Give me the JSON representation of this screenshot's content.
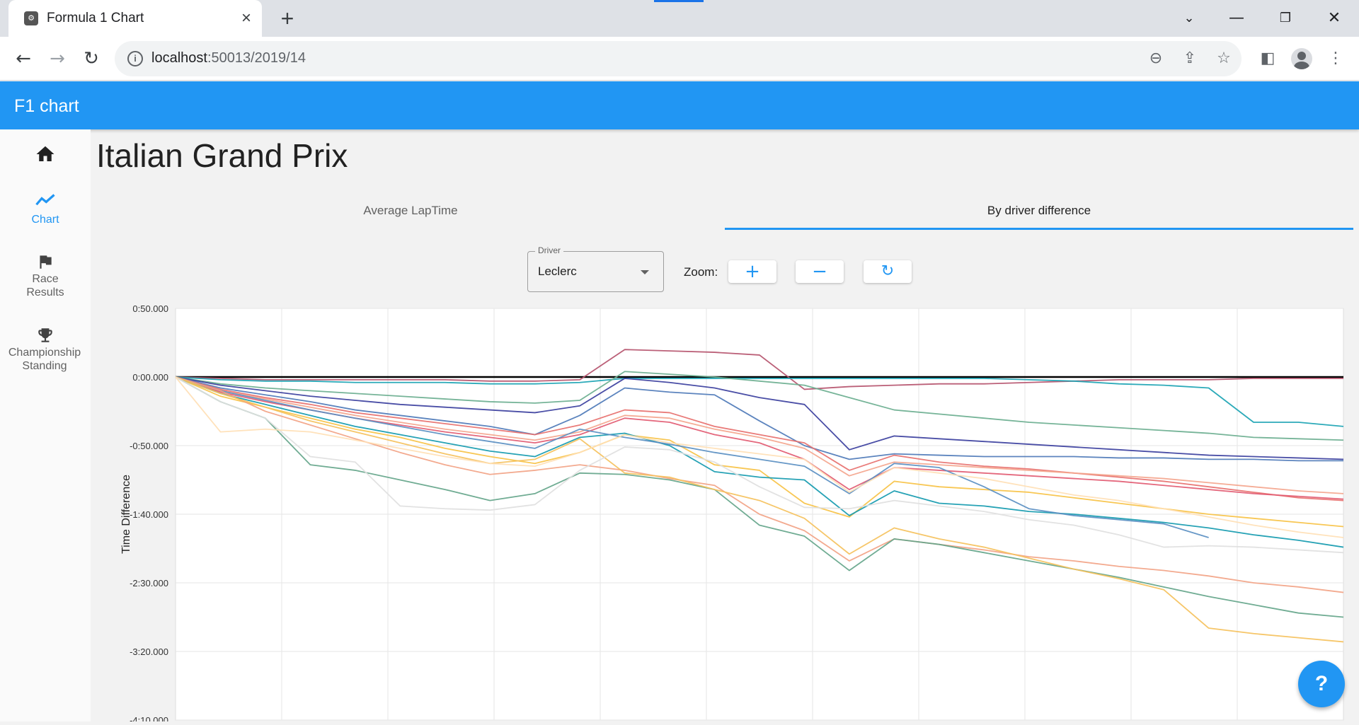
{
  "browser": {
    "tab_title": "Formula 1 Chart",
    "url_host": "localhost",
    "url_rest": ":50013/2019/14"
  },
  "app": {
    "title": "F1 chart"
  },
  "rail": {
    "items": [
      {
        "label": "",
        "icon": "home-icon"
      },
      {
        "label": "Chart",
        "icon": "chart-line-icon",
        "active": true
      },
      {
        "label": "Race Results",
        "icon": "flag-icon"
      },
      {
        "label": "Championship Standing",
        "icon": "trophy-icon"
      }
    ]
  },
  "page": {
    "title": "Italian Grand Prix"
  },
  "tabs": [
    {
      "label": "Average LapTime",
      "active": false
    },
    {
      "label": "By driver difference",
      "active": true
    }
  ],
  "controls": {
    "driver_label": "Driver",
    "driver_value": "Leclerc",
    "zoom_label": "Zoom:"
  },
  "chart_data": {
    "type": "line",
    "ylabel": "Time Difference",
    "ytick_labels": [
      "0:50.000",
      "0:00.000",
      "-0:50.000",
      "-1:40.000",
      "-2:30.000",
      "-3:20.000",
      "-4:10.000"
    ],
    "ylim_seconds": [
      -250,
      50
    ],
    "x": [
      1,
      3,
      5,
      7,
      9,
      11,
      13,
      15,
      17,
      19,
      21,
      23,
      25,
      27,
      29,
      31,
      33,
      35,
      37,
      39,
      41,
      43,
      45,
      47,
      49,
      51,
      53
    ],
    "series": [
      {
        "color": "#000000",
        "values": [
          0,
          0,
          0,
          0,
          0,
          0,
          0,
          0,
          0,
          0,
          0,
          0,
          0,
          0,
          0,
          0,
          0,
          0,
          0,
          0,
          0,
          0,
          0,
          0,
          0,
          0,
          0
        ]
      },
      {
        "color": "#b5526d",
        "values": [
          0,
          -1,
          -2,
          -2,
          -2,
          -2,
          -2,
          -3,
          -3,
          -2,
          20,
          19,
          18,
          16,
          -9,
          -7,
          -6,
          -5,
          -5,
          -4,
          -3,
          -2,
          -2,
          -2,
          -1,
          -1,
          -1
        ]
      },
      {
        "color": "#1aa3b3",
        "values": [
          0,
          -2,
          -3,
          -3,
          -4,
          -4,
          -4,
          -5,
          -5,
          -4,
          -1,
          -1,
          -1,
          -1,
          -1,
          -1,
          -1,
          -1,
          -1,
          -2,
          -3,
          -5,
          -6,
          -8,
          -33,
          -33,
          -36
        ]
      },
      {
        "color": "#6aae8f",
        "values": [
          0,
          -5,
          -8,
          -10,
          -12,
          -14,
          -16,
          -18,
          -19,
          -17,
          4,
          2,
          0,
          -3,
          -6,
          -15,
          -24,
          -27,
          -30,
          -33,
          -35,
          -37,
          -39,
          -41,
          -44,
          -45,
          -46
        ]
      },
      {
        "color": "#3b3f9e",
        "values": [
          0,
          -6,
          -10,
          -14,
          -17,
          -20,
          -22,
          -24,
          -26,
          -21,
          -1,
          -4,
          -8,
          -15,
          -20,
          -53,
          -43,
          -45,
          -47,
          -49,
          -51,
          -53,
          -55,
          -57,
          -58,
          -59,
          -60
        ]
      },
      {
        "color": "#4e7ab8",
        "values": [
          0,
          -8,
          -13,
          -18,
          -24,
          -28,
          -32,
          -36,
          -42,
          -28,
          -8,
          -11,
          -13,
          -32,
          -50,
          -60,
          -56,
          -57,
          -58,
          -58,
          -58,
          -59,
          -59,
          -60,
          -60,
          -61,
          -61
        ]
      },
      {
        "color": "#e7706e",
        "values": [
          0,
          -9,
          -15,
          -20,
          -26,
          -30,
          -34,
          -38,
          -42,
          -35,
          -24,
          -26,
          -36,
          -42,
          -48,
          -68,
          -57,
          -62,
          -65,
          -67,
          -70,
          -73,
          -76,
          -80,
          -84,
          -88,
          -90
        ]
      },
      {
        "color": "#f4a58d",
        "values": [
          0,
          -10,
          -16,
          -22,
          -28,
          -33,
          -38,
          -42,
          -46,
          -40,
          -28,
          -30,
          -38,
          -44,
          -52,
          -72,
          -62,
          -64,
          -66,
          -68,
          -70,
          -72,
          -74,
          -77,
          -80,
          -83,
          -85
        ]
      },
      {
        "color": "#e25b72",
        "values": [
          0,
          -11,
          -18,
          -24,
          -30,
          -35,
          -40,
          -44,
          -48,
          -42,
          -30,
          -33,
          -42,
          -48,
          -60,
          -82,
          -66,
          -68,
          -70,
          -72,
          -74,
          -76,
          -79,
          -82,
          -85,
          -87,
          -89
        ]
      },
      {
        "color": "#f7c245",
        "values": [
          0,
          -14,
          -22,
          -30,
          -38,
          -44,
          -52,
          -58,
          -63,
          -55,
          -42,
          -46,
          -64,
          -68,
          -92,
          -102,
          -76,
          -80,
          -82,
          -84,
          -88,
          -92,
          -96,
          -100,
          -103,
          -106,
          -109
        ]
      },
      {
        "color": "#149aaf",
        "values": [
          0,
          -12,
          -20,
          -28,
          -36,
          -42,
          -48,
          -54,
          -58,
          -44,
          -41,
          -50,
          -69,
          -73,
          -75,
          -101,
          -83,
          -92,
          -94,
          -98,
          -100,
          -103,
          -106,
          -110,
          -115,
          -119,
          -124
        ]
      },
      {
        "color": "#5a8fc2",
        "values": [
          0,
          -10,
          -17,
          -24,
          -30,
          -36,
          -42,
          -47,
          -52,
          -38,
          -44,
          -49,
          -55,
          -60,
          -65,
          -85,
          -63,
          -66,
          -80,
          -96,
          -101,
          -104,
          -107,
          -117
        ]
      },
      {
        "color": "#f2a385",
        "values": [
          0,
          -10,
          -25,
          -35,
          -45,
          -55,
          -64,
          -71,
          -68,
          -64,
          -68,
          -74,
          -79,
          -100,
          -112,
          -134,
          -118,
          -122,
          -126,
          -131,
          -134,
          -138,
          -141,
          -145,
          -150,
          -153,
          -157
        ]
      },
      {
        "color": "#64a58a",
        "values": [
          0,
          -18,
          -30,
          -64,
          -68,
          -75,
          -82,
          -90,
          -85,
          -70,
          -71,
          -75,
          -82,
          -108,
          -116,
          -141,
          -118,
          -122,
          -128,
          -134,
          -140,
          -146,
          -153,
          -160,
          -166,
          -172,
          -175
        ]
      },
      {
        "color": "#f5c15c",
        "values": [
          0,
          -12,
          -22,
          -32,
          -40,
          -48,
          -56,
          -63,
          -60,
          -45,
          -70,
          -73,
          -82,
          -90,
          -103,
          -129,
          -110,
          -118,
          -124,
          -132,
          -140,
          -147,
          -155,
          -183,
          -187,
          -190,
          -193
        ]
      },
      {
        "color": "#e0e0e0",
        "values": [
          0,
          -18,
          -30,
          -58,
          -62,
          -94,
          -96,
          -97,
          -93,
          -68,
          -51,
          -53,
          -62,
          -80,
          -95,
          -96,
          -90,
          -94,
          -98,
          -104,
          -108,
          -115,
          -124,
          -123,
          -124,
          -126,
          -128
        ]
      },
      {
        "color": "#ffe0b5",
        "values": [
          0,
          -40,
          -38,
          -40,
          -46,
          -52,
          -58,
          -63,
          -65,
          -55,
          -42,
          -48,
          -52,
          -56,
          -60,
          -84,
          -66,
          -70,
          -74,
          -80,
          -86,
          -90,
          -96,
          -102,
          -108,
          -113,
          -117
        ]
      }
    ]
  },
  "help": {
    "label": "?"
  }
}
